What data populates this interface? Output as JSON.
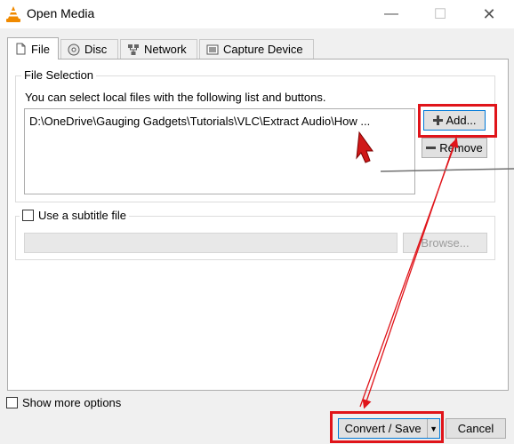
{
  "window": {
    "title": "Open Media",
    "minimize_glyph": "—",
    "maximize_glyph": "☐",
    "close_glyph": "✕"
  },
  "tabs": [
    {
      "label": "File",
      "icon": "file-icon",
      "active": true
    },
    {
      "label": "Disc",
      "icon": "disc-icon",
      "active": false
    },
    {
      "label": "Network",
      "icon": "network-icon",
      "active": false
    },
    {
      "label": "Capture Device",
      "icon": "capture-device-icon",
      "active": false
    }
  ],
  "file_selection": {
    "group_label": "File Selection",
    "instruction": "You can select local files with the following list and buttons.",
    "files": [
      "D:\\OneDrive\\Gauging Gadgets\\Tutorials\\VLC\\Extract Audio\\How ..."
    ],
    "add_label": "Add...",
    "remove_label": "Remove"
  },
  "subtitle": {
    "checkbox_label": "Use a subtitle file",
    "checked": false,
    "path_value": "",
    "browse_label": "Browse..."
  },
  "show_more_options": {
    "label": "Show more options",
    "checked": false
  },
  "footer": {
    "convert_label": "Convert / Save",
    "cancel_label": "Cancel"
  },
  "colors": {
    "highlight": "#e0141a",
    "focus_border": "#0078d7",
    "vlc_orange": "#f08a00"
  }
}
